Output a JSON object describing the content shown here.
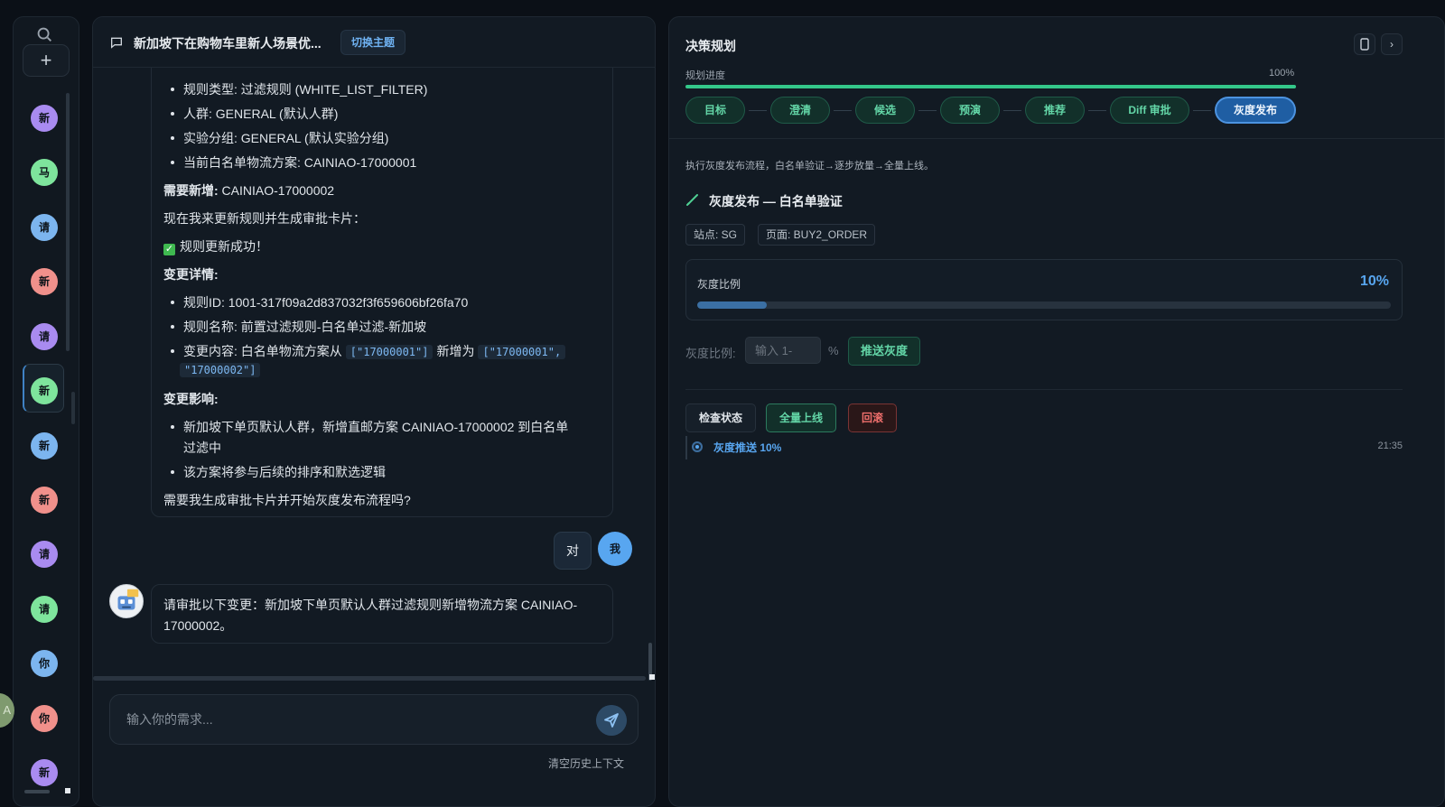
{
  "colors": {
    "background": "#0b1017",
    "panel": "#121a23",
    "accent_blue": "#58a6f0",
    "accent_green": "#34c88a",
    "danger_red": "#ef6f6c"
  },
  "rail": {
    "search_icon": "search-icon",
    "add_label": "+",
    "conversations": [
      {
        "initial": "新",
        "color": "purple"
      },
      {
        "initial": "马",
        "color": "green"
      },
      {
        "initial": "请",
        "color": "blue"
      },
      {
        "initial": "新",
        "color": "red"
      },
      {
        "initial": "请",
        "color": "purple"
      },
      {
        "initial": "新",
        "color": "green",
        "selected": true
      },
      {
        "initial": "新",
        "color": "blue"
      },
      {
        "initial": "新",
        "color": "red"
      },
      {
        "initial": "请",
        "color": "purple"
      },
      {
        "initial": "请",
        "color": "green"
      },
      {
        "initial": "你",
        "color": "blue"
      },
      {
        "initial": "你",
        "color": "red"
      },
      {
        "initial": "新",
        "color": "purple"
      }
    ],
    "ghost_avatar": "A"
  },
  "chat": {
    "title": "新加坡下在购物车里新人场景优...",
    "switch_topic": "切换主题",
    "bullets_top": [
      "规则类型: 过滤规则 (WHITE_LIST_FILTER)",
      "人群: GENERAL (默认人群)",
      "实验分组: GENERAL (默认实验分组)",
      "当前白名单物流方案: CAINIAO-17000001"
    ],
    "need_add_label": "需要新增:",
    "need_add_value": " CAINIAO-17000002",
    "now_update": "现在我来更新规则并生成审批卡片：",
    "update_success": "规则更新成功！",
    "change_details": "变更详情:",
    "rule_id": "规则ID: 1001-317f09a2d837032f3f659606bf26fa70",
    "rule_name": "规则名称: 前置过滤规则-白名单过滤-新加坡",
    "change_content_prefix": "变更内容: 白名单物流方案从",
    "code_old": "[\"17000001\"]",
    "change_content_mid": "新增为",
    "code_new_1": "[\"17000001\",",
    "code_new_2": "\"17000002\"]",
    "change_impact": "变更影响:",
    "impact_1a": "新加坡下单页默认人群，新增直邮方案 CAINIAO-17000002 到白名单",
    "impact_1b": "过滤中",
    "impact_2": "该方案将参与后续的排序和默选逻辑",
    "question": "需要我生成审批卡片并开始灰度发布流程吗?",
    "user_reply": "对",
    "user_avatar": "我",
    "bot_message": "请审批以下变更：新加坡下单页默认人群过滤规则新增物流方案 CAINIAO-17000002。",
    "input_placeholder": "输入你的需求...",
    "clear_history": "清空历史上下文"
  },
  "panel": {
    "title": "决策规划",
    "progress_label": "规划进度",
    "progress_pct_text": "100%",
    "progress_value": 100,
    "steps": [
      "目标",
      "澄清",
      "候选",
      "预演",
      "推荐",
      "Diff 审批",
      "灰度发布"
    ],
    "active_step": 6,
    "description": "执行灰度发布流程，白名单验证→逐步放量→全量上线。",
    "stage_title": "灰度发布 — 白名单验证",
    "tag_site": "站点: SG",
    "tag_page": "页面: BUY2_ORDER",
    "ratio_label": "灰度比例",
    "ratio_text": "10%",
    "ratio_value": 10,
    "form_label": "灰度比例:",
    "form_placeholder": "输入 1-",
    "form_unit": "%",
    "push_button": "推送灰度",
    "check_status": "检查状态",
    "full_release": "全量上线",
    "rollback": "回滚",
    "log_entry": "灰度推送 10%",
    "log_time": "21:35"
  }
}
